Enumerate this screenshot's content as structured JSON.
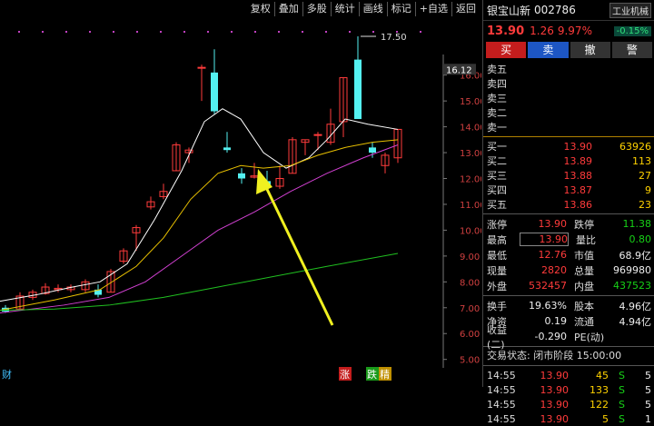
{
  "toolbar": [
    "复权",
    "叠加",
    "多股",
    "统计",
    "画线",
    "标记",
    "+自选",
    "返回"
  ],
  "axis": {
    "current_price": "16.12",
    "ticks": [
      "16.00",
      "15.00",
      "14.00",
      "13.00",
      "12.00",
      "11.00",
      "10.00",
      "9.00",
      "8.00",
      "7.00",
      "6.00",
      "5.00"
    ],
    "high_marker": "17.50"
  },
  "chart_labels": {
    "left": "财",
    "zhang": "涨",
    "die": "跌",
    "jing": "精"
  },
  "stock": {
    "name": "银宝山新",
    "code": "002786",
    "sector": "工业机械",
    "sector_change": "-0.15%",
    "price": "13.90",
    "change": "1.26",
    "pct": "9.97%"
  },
  "buttons": [
    "买",
    "卖",
    "撤",
    "警"
  ],
  "asks": [
    {
      "label": "卖五",
      "price": "",
      "vol": ""
    },
    {
      "label": "卖四",
      "price": "",
      "vol": ""
    },
    {
      "label": "卖三",
      "price": "",
      "vol": ""
    },
    {
      "label": "卖二",
      "price": "",
      "vol": ""
    },
    {
      "label": "卖一",
      "price": "",
      "vol": ""
    }
  ],
  "bids": [
    {
      "label": "买一",
      "price": "13.90",
      "vol": "63926"
    },
    {
      "label": "买二",
      "price": "13.89",
      "vol": "113"
    },
    {
      "label": "买三",
      "price": "13.88",
      "vol": "27"
    },
    {
      "label": "买四",
      "price": "13.87",
      "vol": "9"
    },
    {
      "label": "买五",
      "price": "13.86",
      "vol": "23"
    }
  ],
  "stats1": [
    {
      "a": "涨停",
      "b": "13.90",
      "bc": "red",
      "c": "跌停",
      "d": "11.38",
      "dc": "green"
    },
    {
      "a": "最高",
      "b": "13.90",
      "bc": "red",
      "c": "量比",
      "d": "0.80",
      "dc": "green"
    },
    {
      "a": "最低",
      "b": "12.76",
      "bc": "red",
      "c": "市值",
      "d": "68.9亿",
      "dc": "white"
    },
    {
      "a": "现量",
      "b": "2820",
      "bc": "red",
      "c": "总量",
      "d": "969980",
      "dc": "white"
    },
    {
      "a": "外盘",
      "b": "532457",
      "bc": "red",
      "c": "内盘",
      "d": "437523",
      "dc": "green"
    }
  ],
  "stats2": [
    {
      "a": "换手",
      "b": "19.63%",
      "bc": "white",
      "c": "股本",
      "d": "4.96亿",
      "dc": "white"
    },
    {
      "a": "净资",
      "b": "0.19",
      "bc": "white",
      "c": "流通",
      "d": "4.94亿",
      "dc": "white"
    },
    {
      "a": "收益(二)",
      "b": "-0.290",
      "bc": "white",
      "c": "PE(动)",
      "d": "",
      "dc": "white"
    }
  ],
  "trade_status": "交易状态: 闭市阶段 15:00:00",
  "ticks": [
    {
      "t": "14:55",
      "p": "13.90",
      "v": "45",
      "s": "S",
      "n": "5"
    },
    {
      "t": "14:55",
      "p": "13.90",
      "v": "133",
      "s": "S",
      "n": "5"
    },
    {
      "t": "14:55",
      "p": "13.90",
      "v": "122",
      "s": "S",
      "n": "5"
    },
    {
      "t": "14:55",
      "p": "13.90",
      "v": "5",
      "s": "S",
      "n": "1"
    }
  ],
  "colors": {
    "up": "#ff3b3b",
    "down": "#54f0f0",
    "ma5": "#ffffff",
    "ma10": "#e8c000",
    "ma20": "#d040d0",
    "ma60": "#20c020",
    "arrow": "#f0f020"
  }
}
